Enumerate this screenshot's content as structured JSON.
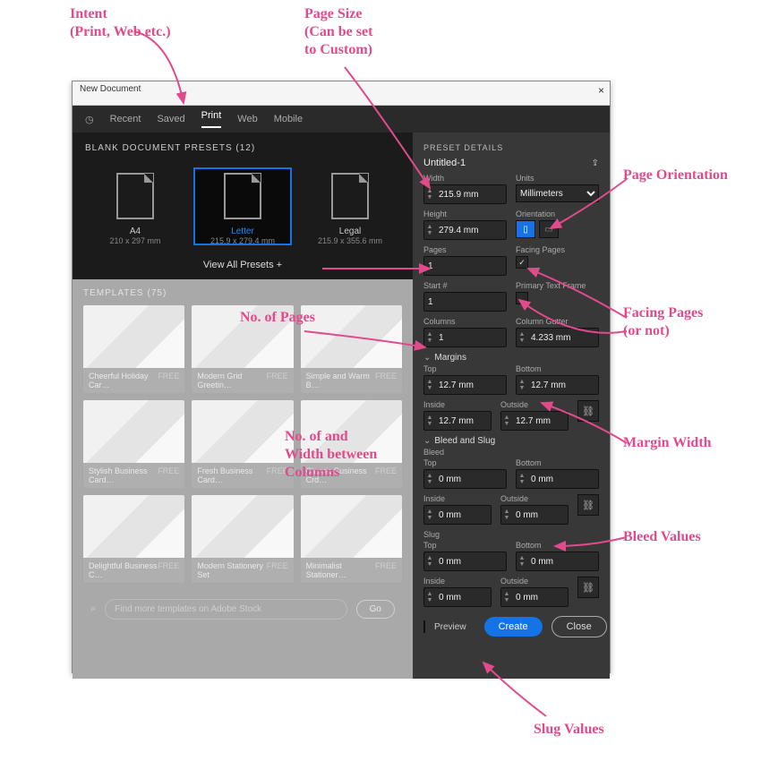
{
  "window": {
    "title": "New Document"
  },
  "tabs": {
    "recent": "Recent",
    "saved": "Saved",
    "print": "Print",
    "web": "Web",
    "mobile": "Mobile"
  },
  "presets": {
    "header": "BLANK DOCUMENT PRESETS  (12)",
    "items": [
      {
        "name": "A4",
        "dim": "210 x 297 mm"
      },
      {
        "name": "Letter",
        "dim": "215.9 x 279.4 mm"
      },
      {
        "name": "Legal",
        "dim": "215.9 x 355.6 mm"
      }
    ],
    "view_all": "View All Presets +"
  },
  "templates": {
    "header": "TEMPLATES  (75)",
    "items": [
      {
        "name": "Cheerful Holiday Car…",
        "price": "FREE"
      },
      {
        "name": "Modern Grid Greetin…",
        "price": "FREE"
      },
      {
        "name": "Simple and Warm B…",
        "price": "FREE"
      },
      {
        "name": "Stylish Business Card…",
        "price": "FREE"
      },
      {
        "name": "Fresh Business Card…",
        "price": "FREE"
      },
      {
        "name": "Classic Business Crd…",
        "price": "FREE"
      },
      {
        "name": "Delightful Business C…",
        "price": "FREE"
      },
      {
        "name": "Modern Stationery Set",
        "price": "FREE"
      },
      {
        "name": "Minimalist Stationer…",
        "price": "FREE"
      }
    ],
    "search_placeholder": "Find more templates on Adobe Stock",
    "go": "Go"
  },
  "details": {
    "header": "PRESET DETAILS",
    "name": "Untitled-1",
    "width_label": "Width",
    "width": "215.9 mm",
    "units_label": "Units",
    "units": "Millimeters",
    "height_label": "Height",
    "height": "279.4 mm",
    "orient_label": "Orientation",
    "pages_label": "Pages",
    "pages": "1",
    "facing_label": "Facing Pages",
    "start_label": "Start #",
    "start": "1",
    "ptf_label": "Primary Text Frame",
    "columns_label": "Columns",
    "columns": "1",
    "gutter_label": "Column Gutter",
    "gutter": "4.233 mm",
    "margins_h": "Margins",
    "m_top_l": "Top",
    "m_top": "12.7 mm",
    "m_bot_l": "Bottom",
    "m_bot": "12.7 mm",
    "m_in_l": "Inside",
    "m_in": "12.7 mm",
    "m_out_l": "Outside",
    "m_out": "12.7 mm",
    "bleed_h": "Bleed and Slug",
    "bleed_l": "Bleed",
    "slug_l": "Slug",
    "b_top": "0 mm",
    "b_bot": "0 mm",
    "b_in": "0 mm",
    "b_out": "0 mm",
    "s_top": "0 mm",
    "s_bot": "0 mm",
    "s_in": "0 mm",
    "s_out": "0 mm",
    "preview": "Preview",
    "create": "Create",
    "close": "Close"
  },
  "annotations": {
    "intent": "Intent\n(Print, Web etc.)",
    "pagesize": "Page Size\n(Can be set\nto Custom)",
    "orient": "Page Orientation",
    "pages": "No. of Pages",
    "facing": "Facing Pages\n(or not)",
    "columns": "No. of and\nWidth between\nColumns",
    "margins": "Margin Width",
    "bleed": "Bleed Values",
    "slug": "Slug Values"
  }
}
